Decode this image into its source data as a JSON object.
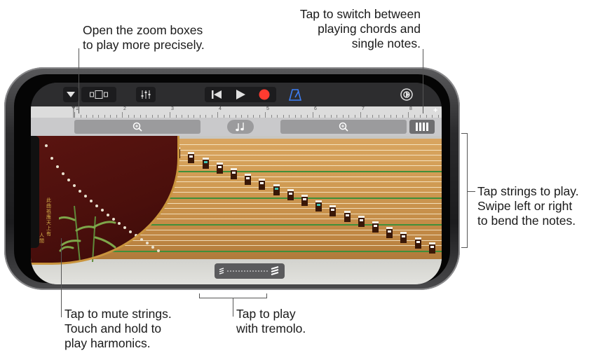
{
  "callouts": {
    "zoom": "Open the zoom boxes\nto play more precisely.",
    "chords": "Tap to switch between\nplaying chords and\nsingle notes.",
    "strings": "Tap strings to play.\nSwipe left or right\nto bend the notes.",
    "mute": "Tap to mute strings.\nTouch and hold to\nplay harmonics.",
    "tremolo": "Tap to play\nwith tremolo."
  },
  "ruler": {
    "numbers": [
      "1",
      "2",
      "3",
      "4",
      "5",
      "6",
      "7",
      "8"
    ],
    "plus": "+"
  },
  "toolbar": {
    "icons": [
      "dropdown-arrow-icon",
      "track-view-icon",
      "mixer-icon",
      "rewind-icon",
      "play-icon",
      "record-icon",
      "metronome-icon",
      "settings-icon"
    ]
  },
  "instrument": {
    "poem_col1": "此曲祇應天上有",
    "poem_col2": "人間"
  },
  "colors": {
    "record": "#ff3b30",
    "metronome": "#3d7ff5",
    "soundboard": "#cf9a52",
    "headstock": "#4a0f0c"
  }
}
